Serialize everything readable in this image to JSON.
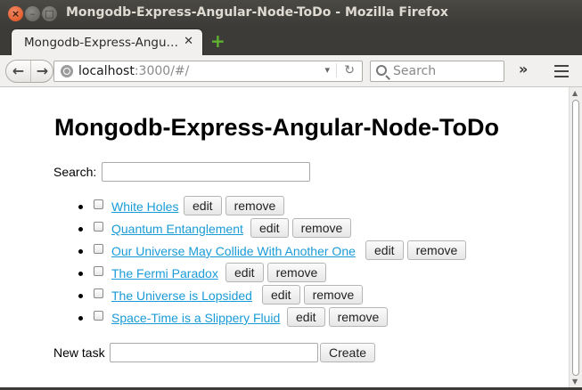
{
  "window": {
    "title": "Mongodb-Express-Angular-Node-ToDo - Mozilla Firefox"
  },
  "tab": {
    "label": "Mongodb-Express-Angu…",
    "close": "✕",
    "new_tab": "+"
  },
  "nav": {
    "back": "←",
    "forward": "→",
    "url_host": "localhost",
    "url_path": ":3000/#/",
    "url_dropdown": "▾",
    "reload": "↻",
    "search_placeholder": "Search",
    "overflow": "»"
  },
  "page": {
    "title": "Mongodb-Express-Angular-Node-ToDo",
    "search_label": "Search:",
    "search_value": "",
    "todos": [
      {
        "text": "White Holes",
        "checked": false
      },
      {
        "text": "Quantum Entanglement",
        "checked": false
      },
      {
        "text": "Our Universe May Collide With Another One",
        "checked": false
      },
      {
        "text": "The Fermi Paradox",
        "checked": false
      },
      {
        "text": "The Universe is Lopsided",
        "checked": false
      },
      {
        "text": "Space-Time is a Slippery Fluid",
        "checked": false
      }
    ],
    "edit_label": "edit",
    "remove_label": "remove",
    "new_task_label": "New task",
    "new_task_value": "",
    "create_label": "Create"
  },
  "colors": {
    "link": "#1a9bd7",
    "close_button": "#df4b16",
    "new_tab_plus": "#5fb330"
  }
}
